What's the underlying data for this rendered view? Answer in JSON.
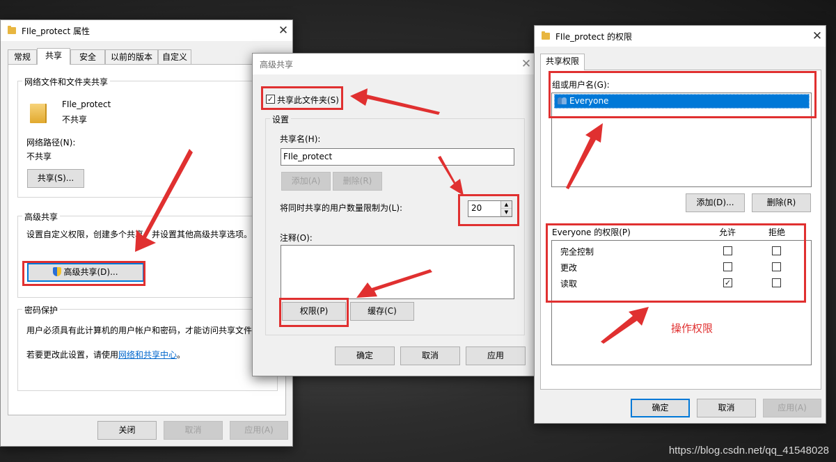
{
  "props_window": {
    "title": "FIle_protect 属性",
    "tabs": [
      "常规",
      "共享",
      "安全",
      "以前的版本",
      "自定义"
    ],
    "active_tab": "共享",
    "network_group_title": "网络文件和文件夹共享",
    "folder_name": "FIle_protect",
    "folder_status": "不共享",
    "network_path_label": "网络路径(N):",
    "network_path_value": "不共享",
    "share_button": "共享(S)...",
    "advanced_group_title": "高级共享",
    "advanced_desc": "设置自定义权限，创建多个共享，并设置其他高级共享选项。",
    "advanced_button": "高级共享(D)...",
    "password_group_title": "密码保护",
    "password_desc": "用户必须具有此计算机的用户帐户和密码，才能访问共享文件夹。",
    "change_desc_prefix": "若要更改此设置，请使用",
    "change_link": "网络和共享中心",
    "change_desc_suffix": "。",
    "close_button": "关闭",
    "cancel_button": "取消",
    "apply_button": "应用(A)"
  },
  "adv_window": {
    "title": "高级共享",
    "share_checkbox_label": "共享此文件夹(S)",
    "share_checked": true,
    "settings_title": "设置",
    "share_name_label": "共享名(H):",
    "share_name_value": "FIle_protect",
    "add_button": "添加(A)",
    "remove_button": "删除(R)",
    "limit_label": "将同时共享的用户数量限制为(L):",
    "limit_value": "20",
    "comment_label": "注释(O):",
    "permissions_button": "权限(P)",
    "cache_button": "缓存(C)",
    "ok_button": "确定",
    "cancel_button": "取消",
    "apply_button": "应用"
  },
  "perm_window": {
    "title": "FIle_protect 的权限",
    "tab": "共享权限",
    "group_label": "组或用户名(G):",
    "users": [
      "Everyone"
    ],
    "add_button": "添加(D)...",
    "remove_button": "删除(R)",
    "perm_header": "Everyone 的权限(P)",
    "allow_header": "允许",
    "deny_header": "拒绝",
    "permissions": [
      {
        "name": "完全控制",
        "allow": false,
        "deny": false
      },
      {
        "name": "更改",
        "allow": false,
        "deny": false
      },
      {
        "name": "读取",
        "allow": true,
        "deny": false
      }
    ],
    "annotation": "操作权限",
    "ok_button": "确定",
    "cancel_button": "取消",
    "apply_button": "应用(A)"
  },
  "watermark": "https://blog.csdn.net/qq_41548028",
  "colors": {
    "annotation_red": "#e03030",
    "selection_blue": "#0078d7",
    "link_blue": "#0066cc"
  }
}
